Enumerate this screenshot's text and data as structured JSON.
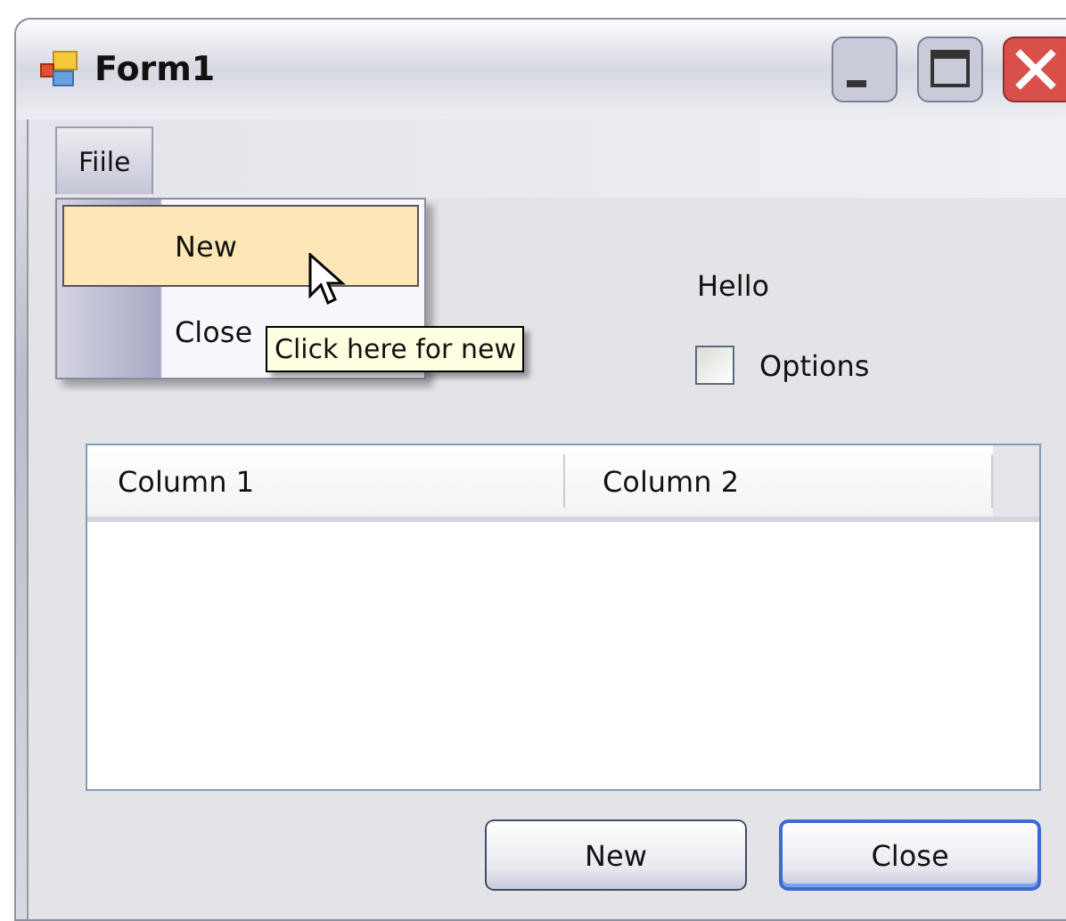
{
  "window": {
    "title": "Form1"
  },
  "menu": [
    {
      "label": "Fiile",
      "expanded": true,
      "items": [
        {
          "label": "New",
          "selected": true
        },
        {
          "label": "Close",
          "selected": false
        }
      ]
    }
  ],
  "tooltip": "Click here for new",
  "label": "Hello",
  "checkbox": {
    "label": "Options",
    "checked": false
  },
  "list": {
    "columns": [
      "Column 1",
      "Column 2"
    ]
  },
  "buttons": [
    {
      "label": "New",
      "default": false
    },
    {
      "label": "Close",
      "default": true
    }
  ]
}
